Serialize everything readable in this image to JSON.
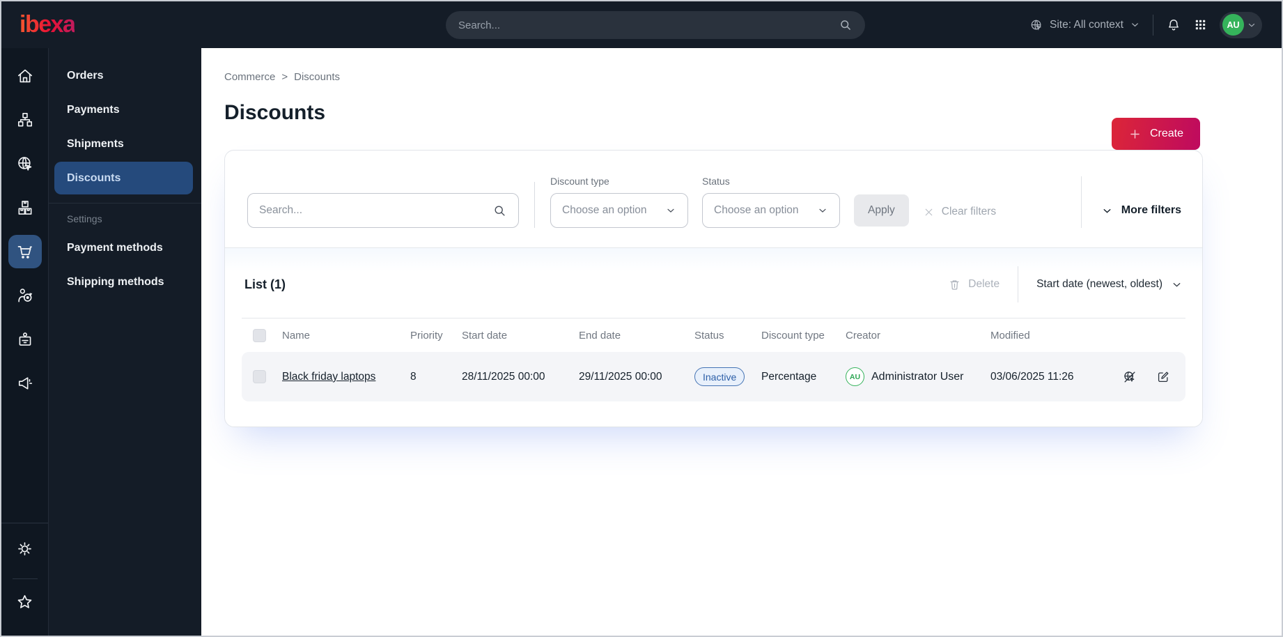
{
  "topbar": {
    "logo": "ibexa",
    "search_placeholder": "Search...",
    "site_context": "Site: All context",
    "avatar_initials": "AU"
  },
  "sidebar": {
    "rail_icons": [
      "home-icon",
      "content-tree-icon",
      "site-globe-icon",
      "products-boxes-icon",
      "commerce-cart-icon",
      "customers-target-icon",
      "members-badge-icon",
      "marketing-megaphone-icon",
      "settings-gear-icon",
      "bookmarks-star-icon"
    ],
    "rail_active": "commerce-cart-icon",
    "menu": {
      "items": [
        "Orders",
        "Payments",
        "Shipments",
        "Discounts"
      ],
      "active_item": "Discounts",
      "settings_label": "Settings",
      "settings_items": [
        "Payment methods",
        "Shipping methods"
      ]
    }
  },
  "main": {
    "breadcrumb": {
      "items": [
        "Commerce",
        "Discounts"
      ],
      "separator": ">"
    },
    "title": "Discounts",
    "create_label": "Create",
    "filters": {
      "search_placeholder": "Search...",
      "discount_type_label": "Discount type",
      "discount_type_value": "Choose an option",
      "status_label": "Status",
      "status_value": "Choose an option",
      "apply_label": "Apply",
      "clear_label": "Clear filters",
      "more_filters_label": "More filters"
    },
    "list": {
      "title": "List (1)",
      "delete_label": "Delete",
      "sort_label": "Start date (newest, oldest)",
      "columns": [
        "Name",
        "Priority",
        "Start date",
        "End date",
        "Status",
        "Discount type",
        "Creator",
        "Modified"
      ],
      "rows": [
        {
          "name": "Black friday laptops",
          "priority": "8",
          "start_date": "28/11/2025 00:00",
          "end_date": "29/11/2025 00:00",
          "status": "Inactive",
          "discount_type": "Percentage",
          "creator_initials": "AU",
          "creator_name": "Administrator User",
          "modified": "03/06/2025 11:26"
        }
      ]
    }
  },
  "colors": {
    "topbar_bg": "#141C27",
    "rail_bg": "#0F1721",
    "active_nav_blue": "#254A7C",
    "rail_active_blue": "#305380",
    "brand_gradient_start": "#DC2638",
    "brand_gradient_end": "#BE0A5F",
    "badge_inactive_border": "#4473B4",
    "badge_inactive_bg": "#E8F0FB",
    "badge_inactive_text": "#2B5EA7",
    "avatar_green": "#35B35B",
    "row_bg": "#F4F5F8"
  }
}
